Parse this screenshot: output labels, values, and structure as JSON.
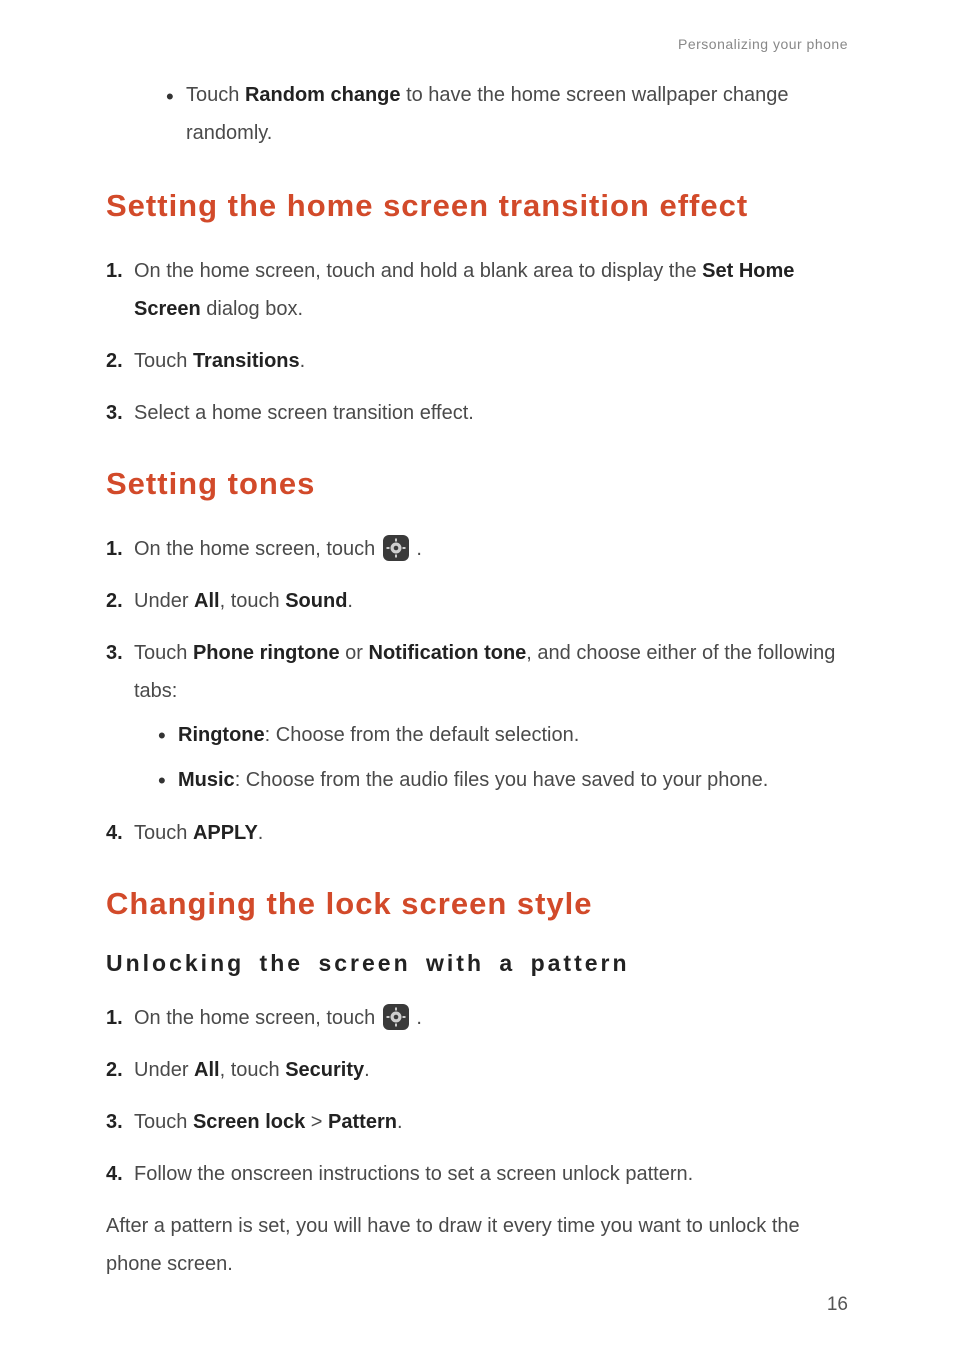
{
  "header": {
    "running": "Personalizing your phone"
  },
  "continuation": {
    "bullet_prefix": "Touch ",
    "bullet_strong": "Random change",
    "bullet_suffix": " to have the home screen wallpaper change randomly."
  },
  "section_transition": {
    "title": "Setting the home screen transition effect",
    "steps": [
      {
        "n": "1.",
        "pre": "On the home screen, touch and hold a blank area to display the ",
        "bold": "Set Home Screen",
        "post": " dialog box."
      },
      {
        "n": "2.",
        "pre": "Touch ",
        "bold": "Transitions",
        "post": "."
      },
      {
        "n": "3.",
        "text": "Select a home screen transition effect."
      }
    ]
  },
  "section_tones": {
    "title": "Setting tones",
    "step1": {
      "n": "1.",
      "text": "On the home screen, touch ",
      "tail": "."
    },
    "step2": {
      "n": "2.",
      "pre": "Under ",
      "b1": "All",
      "mid": ", touch ",
      "b2": "Sound",
      "post": "."
    },
    "step3": {
      "n": "3.",
      "pre": "Touch ",
      "b1": "Phone ringtone",
      "mid1": " or ",
      "b2": "Notification tone",
      "post": ", and choose either of the following tabs:",
      "bullets": [
        {
          "bold": "Ringtone",
          "text": ": Choose from the default selection."
        },
        {
          "bold": "Music",
          "text": ": Choose from the audio files you have saved to your phone."
        }
      ]
    },
    "step4": {
      "n": "4.",
      "pre": "Touch ",
      "bold": "APPLY",
      "post": "."
    }
  },
  "section_lock": {
    "title": "Changing the lock screen style",
    "subtitle": "Unlocking the screen with a pattern",
    "step1": {
      "n": "1.",
      "text": "On the home screen, touch ",
      "tail": "."
    },
    "step2": {
      "n": "2.",
      "pre": "Under ",
      "b1": "All",
      "mid": ", touch ",
      "b2": "Security",
      "post": "."
    },
    "step3": {
      "n": "3.",
      "pre": "Touch ",
      "b1": "Screen lock",
      "sep": " > ",
      "b2": "Pattern",
      "post": "."
    },
    "step4": {
      "n": "4.",
      "text": "Follow the onscreen instructions to set a screen unlock pattern."
    },
    "closing": "After a pattern is set, you will have to draw it every time you want to unlock the phone screen."
  },
  "page_number": "16",
  "icons": {
    "settings": "settings-icon"
  }
}
